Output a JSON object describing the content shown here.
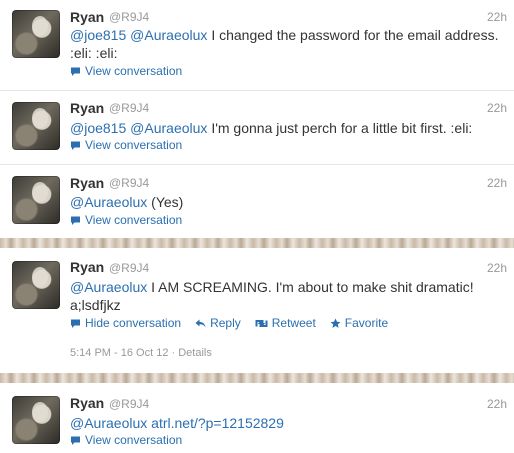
{
  "colors": {
    "link": "#2b6fb1",
    "muted": "#999999",
    "text": "#333333"
  },
  "tweets": [
    {
      "name": "Ryan",
      "handle": "@R9J4",
      "time": "22h",
      "mentions": [
        "@joe815",
        "@Auraeolux"
      ],
      "text": "I changed the password for the email address. :eli: :eli:",
      "conversation_label": "View conversation"
    },
    {
      "name": "Ryan",
      "handle": "@R9J4",
      "time": "22h",
      "mentions": [
        "@joe815",
        "@Auraeolux"
      ],
      "text": "I'm gonna just perch for a little bit first. :eli:",
      "conversation_label": "View conversation"
    },
    {
      "name": "Ryan",
      "handle": "@R9J4",
      "time": "22h",
      "mentions": [
        "@Auraeolux"
      ],
      "text": "(Yes)",
      "conversation_label": "View conversation"
    },
    {
      "name": "Ryan",
      "handle": "@R9J4",
      "time": "22h",
      "mentions": [
        "@Auraeolux"
      ],
      "text": "I AM SCREAMING. I'm about to make shit dramatic! a;lsdfjkz",
      "conversation_label": "Hide conversation",
      "reply_label": "Reply",
      "retweet_label": "Retweet",
      "favorite_label": "Favorite",
      "timestamp": "5:14 PM - 16 Oct 12",
      "details_label": "Details",
      "meta_separator": "·"
    },
    {
      "name": "Ryan",
      "handle": "@R9J4",
      "time": "22h",
      "mentions": [
        "@Auraeolux"
      ],
      "link": "atrl.net/?p=12152829",
      "conversation_label": "View conversation"
    }
  ],
  "icons": {
    "conversation": "speech-bubble-icon",
    "reply": "reply-arrow-icon",
    "retweet": "retweet-icon",
    "favorite": "star-icon"
  }
}
